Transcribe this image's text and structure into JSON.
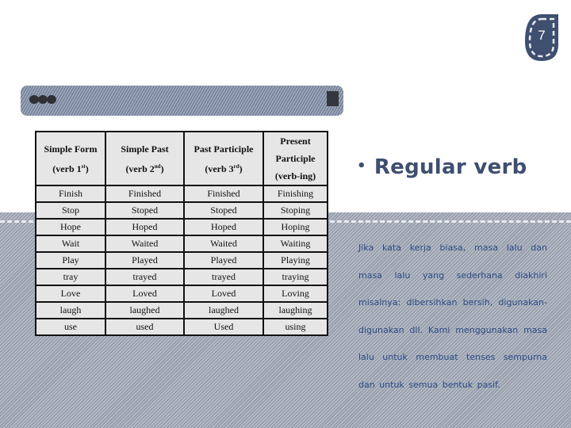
{
  "slide": {
    "page_number": "7",
    "heading_bullet": "•",
    "heading": "Regular verb",
    "description": "Jika kata kerja biasa, masa lalu dan masa lalu yang sederhana diakhiri misalnya: dibersihkan bersih, digunakan-digunakan dll. Kami menggunakan masa lalu untuk membuat tenses sempurna dan untuk semua bentuk pasif."
  },
  "decor": {
    "badge_color": "#3e4f70",
    "heading_color": "#3e4f70",
    "text_color": "#2c4a85"
  },
  "table": {
    "headers": [
      {
        "line1": "Simple Form",
        "line2_pre": "(verb 1",
        "sup": "st",
        "line2_post": ")"
      },
      {
        "line1": "Simple Past",
        "line2_pre": "(verb 2",
        "sup": "nd",
        "line2_post": ")"
      },
      {
        "line1": "Past Participle",
        "line2_pre": "(verb 3",
        "sup": "rd",
        "line2_post": ")"
      },
      {
        "line1": "Present",
        "line1b": "Participle",
        "line2_pre": "(verb-ing)",
        "sup": "",
        "line2_post": ""
      }
    ],
    "rows": [
      [
        "Finish",
        "Finished",
        "Finished",
        "Finishing"
      ],
      [
        "Stop",
        "Stoped",
        "Stoped",
        "Stoping"
      ],
      [
        "Hope",
        "Hoped",
        "Hoped",
        "Hoping"
      ],
      [
        "Wait",
        "Waited",
        "Waited",
        "Waiting"
      ],
      [
        "Play",
        "Played",
        "Played",
        "Playing"
      ],
      [
        "tray",
        "trayed",
        "trayed",
        "traying"
      ],
      [
        "Love",
        "Loved",
        "Loved",
        "Loving"
      ],
      [
        "laugh",
        "laughed",
        "laughed",
        "laughing"
      ],
      [
        "use",
        "used",
        "Used",
        "using"
      ]
    ]
  }
}
